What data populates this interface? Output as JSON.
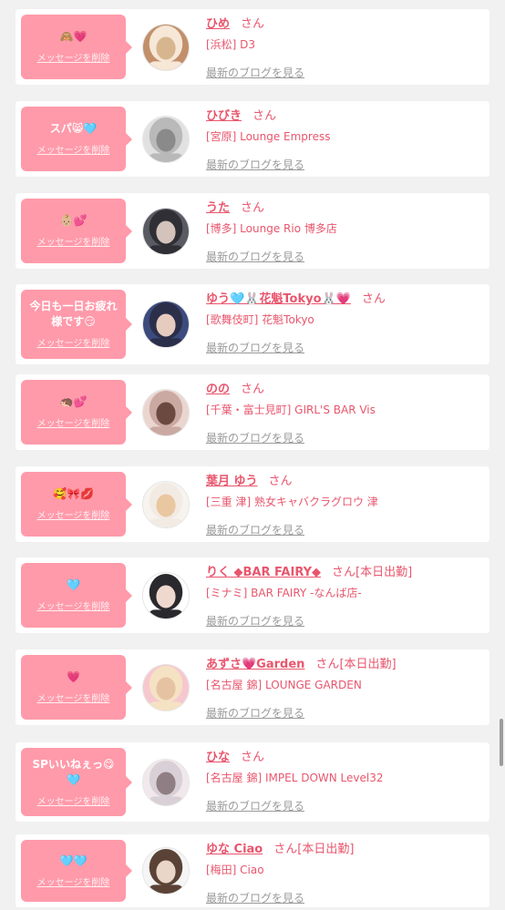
{
  "colors": {
    "accent": "#e8566d",
    "bubble": "#ff9aaa",
    "background": "#f1f1f1",
    "muted": "#9a9a9a"
  },
  "delete_label": "メッセージを削除",
  "blog_label": "最新のブログを見る",
  "san_label": "さん",
  "items": [
    {
      "message": "🙈💗",
      "name": "ひめ",
      "suffix": "",
      "area_shop": "[浜松] D3",
      "avatar_colors": [
        "#f6e7d6",
        "#d7b58e",
        "#c28f6a"
      ]
    },
    {
      "message": "スパ😸🩵",
      "name": "ひびき",
      "suffix": "",
      "area_shop": "[宮原] Lounge Empress",
      "avatar_colors": [
        "#b9b9b9",
        "#8a8a8a",
        "#e1e1e1"
      ]
    },
    {
      "message": "👶🏼💕",
      "name": "うた",
      "suffix": "",
      "area_shop": "[博多] Lounge Rio 博多店",
      "avatar_colors": [
        "#2f2f35",
        "#d3c3bb",
        "#5a5a63"
      ]
    },
    {
      "message": "今日も一日お疲れ\n様です😏",
      "name": "ゆう🩵🐰花魁Tokyo🐰💗",
      "suffix": "",
      "area_shop": "[歌舞伎町] 花魁Tokyo",
      "avatar_colors": [
        "#2b2f4a",
        "#e6cbbf",
        "#3c4b7d"
      ]
    },
    {
      "message": "🦔💕",
      "name": "のの",
      "suffix": "",
      "area_shop": "[千葉・富士見町] GIRL'S BAR Vis",
      "avatar_colors": [
        "#c9a9a2",
        "#6b4840",
        "#ead6cf"
      ]
    },
    {
      "message": "🥰🎀💋",
      "name": "葉月 ゆう",
      "suffix": "",
      "area_shop": "[三重 津] 熟女キャバクラグロウ 津",
      "avatar_colors": [
        "#f2ebe3",
        "#e9c7a0",
        "#f7f3ef"
      ]
    },
    {
      "message": "🩵",
      "name": "りく ◆BAR FAIRY◆",
      "suffix": "[本日出勤]",
      "area_shop": "[ミナミ] BAR FAIRY -なんば店-",
      "avatar_colors": [
        "#2a2a2e",
        "#efd9cf",
        "#ffffff"
      ]
    },
    {
      "message": "💗",
      "name": "あずさ💗Garden",
      "suffix": "[本日出勤]",
      "area_shop": "[名古屋 錦] LOUNGE GARDEN",
      "avatar_colors": [
        "#f4e2c3",
        "#e5c3a2",
        "#f7c7cf"
      ]
    },
    {
      "message": "SPいいねぇっ😋\n🩵",
      "name": "ひな",
      "suffix": "",
      "area_shop": "[名古屋 錦] IMPEL DOWN Level32",
      "avatar_colors": [
        "#d8d0d6",
        "#8f7e83",
        "#f0e8ea"
      ]
    },
    {
      "message": "🩵🩵",
      "name": "ゆな Ciao",
      "suffix": "[本日出勤]",
      "area_shop": "[梅田] Ciao",
      "avatar_colors": [
        "#5a4336",
        "#e9d6c8",
        "#f5f5f5"
      ]
    }
  ]
}
